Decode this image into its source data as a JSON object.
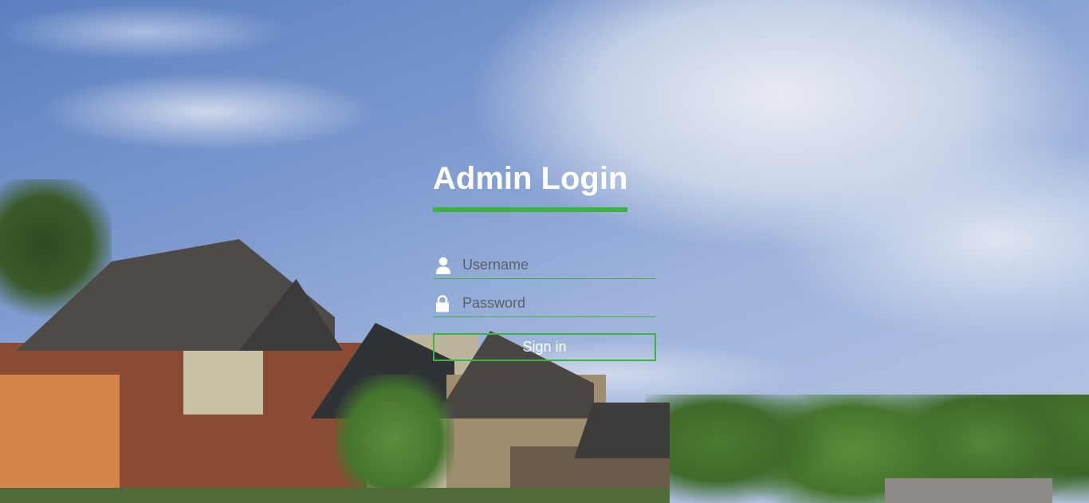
{
  "login": {
    "title": "Admin Login",
    "username_placeholder": "Username",
    "password_placeholder": "Password",
    "signin_label": "Sign in"
  },
  "icons": {
    "username": "user-icon",
    "password": "lock-icon"
  },
  "colors": {
    "accent": "#3db342",
    "text": "#ffffff"
  }
}
